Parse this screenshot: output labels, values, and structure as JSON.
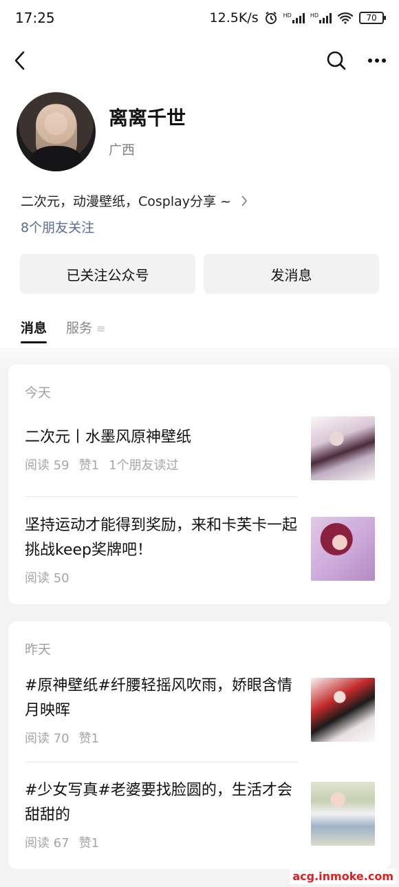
{
  "status_bar": {
    "time": "17:25",
    "net_speed": "12.5K/s",
    "hd1": "HD",
    "hd2": "HD",
    "battery": "70"
  },
  "nav": {
    "back_icon": "chevron-left-icon",
    "search_icon": "search-icon",
    "more_icon": "more-icon"
  },
  "profile": {
    "name": "离离千世",
    "region": "广西",
    "bio": "二次元，动漫壁纸，Cosplay分享 ~",
    "friends_following": "8个朋友关注"
  },
  "actions": {
    "followed_label": "已关注公众号",
    "message_label": "发消息"
  },
  "tabs": [
    {
      "label": "消息"
    },
    {
      "label": "服务"
    }
  ],
  "feed": [
    {
      "day": "今天",
      "articles": [
        {
          "title": "二次元丨水墨风原神壁纸",
          "read": "阅读 59",
          "likes": "赞1",
          "friends_read": "1个朋友读过"
        },
        {
          "title": "坚持运动才能得到奖励，来和卡芙卡一起挑战keep奖牌吧！",
          "read": "阅读 50"
        }
      ]
    },
    {
      "day": "昨天",
      "articles": [
        {
          "title": "#原神壁纸#纤腰轻摇风吹雨，娇眼含情月映晖",
          "read": "阅读 70",
          "likes": "赞1"
        },
        {
          "title": "#少女写真#老婆要找脸圆的，生活才会甜甜的",
          "read": "阅读 67",
          "likes": "赞1"
        }
      ]
    }
  ],
  "watermark": "acg.inmoke.com"
}
